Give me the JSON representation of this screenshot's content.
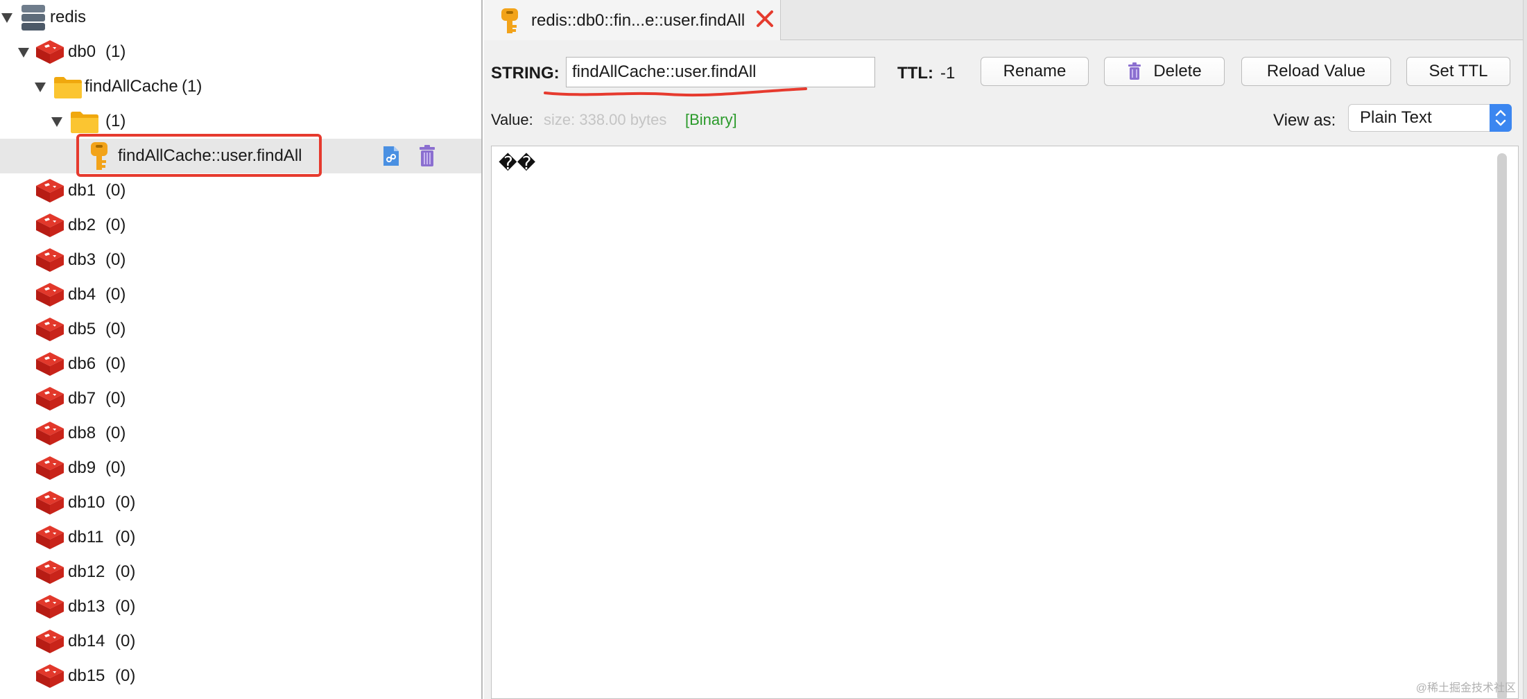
{
  "tree": {
    "server": {
      "label": "redis"
    },
    "db0": {
      "name": "db0",
      "count": "(1)"
    },
    "folder": {
      "name": "findAllCache",
      "count": "(1)"
    },
    "subfolder": {
      "count": "(1)"
    },
    "key": {
      "name": "findAllCache::user.findAll"
    },
    "databases": [
      {
        "name": "db1",
        "count": "(0)"
      },
      {
        "name": "db2",
        "count": "(0)"
      },
      {
        "name": "db3",
        "count": "(0)"
      },
      {
        "name": "db4",
        "count": "(0)"
      },
      {
        "name": "db5",
        "count": "(0)"
      },
      {
        "name": "db6",
        "count": "(0)"
      },
      {
        "name": "db7",
        "count": "(0)"
      },
      {
        "name": "db8",
        "count": "(0)"
      },
      {
        "name": "db9",
        "count": "(0)"
      },
      {
        "name": "db10",
        "count": "(0)"
      },
      {
        "name": "db11",
        "count": "(0)"
      },
      {
        "name": "db12",
        "count": "(0)"
      },
      {
        "name": "db13",
        "count": "(0)"
      },
      {
        "name": "db14",
        "count": "(0)"
      },
      {
        "name": "db15",
        "count": "(0)"
      }
    ]
  },
  "tab": {
    "title": "redis::db0::fin...e::user.findAll"
  },
  "key_view": {
    "type_label": "STRING:",
    "key_name": "findAllCache::user.findAll",
    "ttl_label": "TTL:",
    "ttl_value": "-1",
    "buttons": {
      "rename": "Rename",
      "delete": "Delete",
      "reload": "Reload Value",
      "set_ttl": "Set TTL"
    },
    "value_label": "Value:",
    "size_text": "size: 338.00 bytes",
    "binary_text": "[Binary]",
    "view_as_label": "View as:",
    "view_as_value": "Plain Text",
    "value_content": "��"
  },
  "watermark": "@稀土掘金技术社区",
  "colors": {
    "redis_red": "#d82c20",
    "folder_yellow": "#f7b928",
    "key_orange": "#f2a31a",
    "highlight_red": "#e63a2e",
    "binary_green": "#2a9a2a",
    "select_blue": "#3b86f0"
  }
}
